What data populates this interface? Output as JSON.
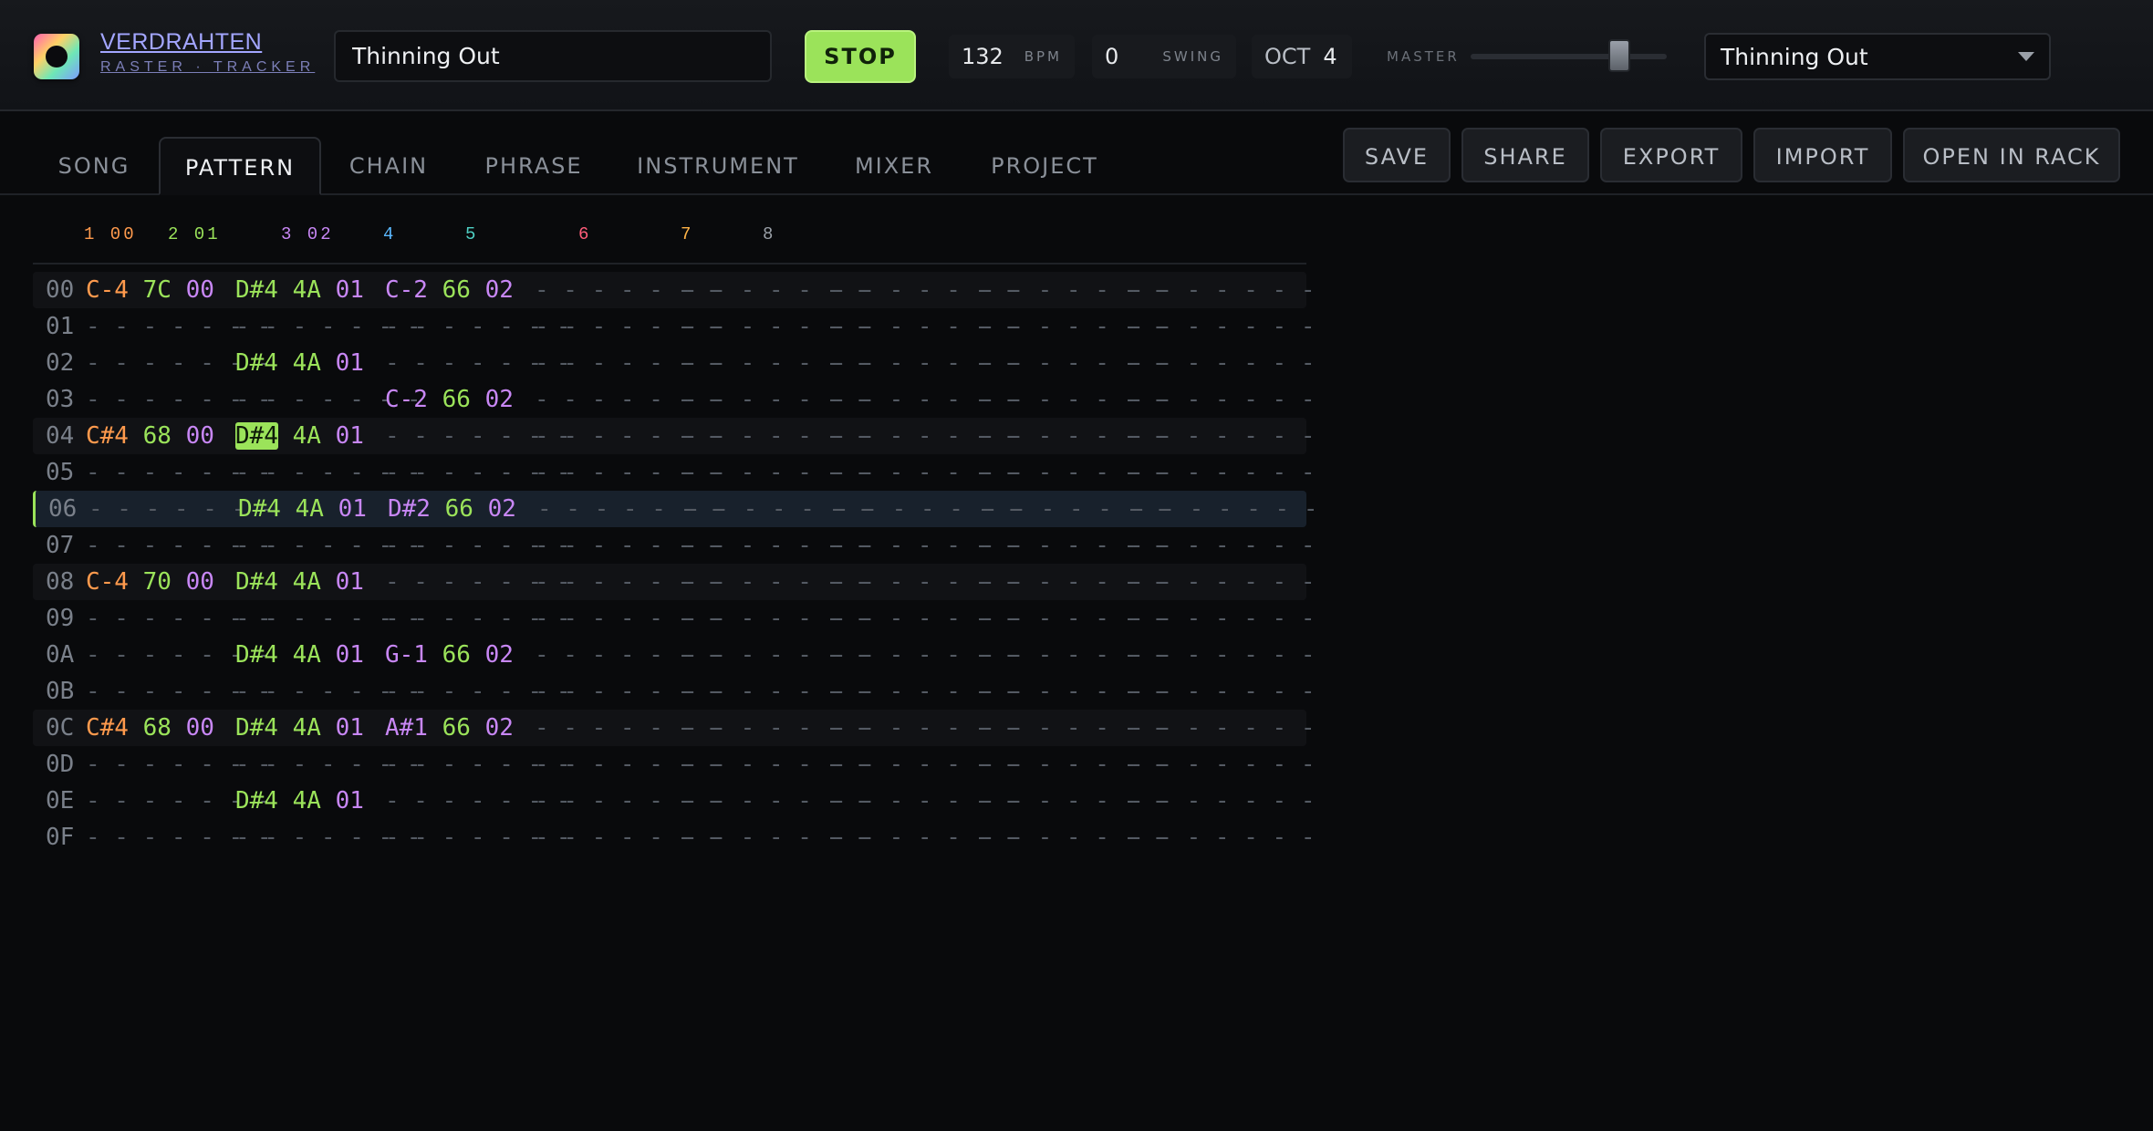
{
  "app": {
    "name": "VERDRAHTEN",
    "subtitle": "RASTER · TRACKER",
    "song_title": "Thinning Out"
  },
  "transport": {
    "stop_label": "STOP",
    "bpm_value": "132",
    "bpm_unit": "BPM",
    "swing_value": "0",
    "swing_unit": "SWING",
    "octave_label": "OCT",
    "octave_value": "4",
    "master_label": "MASTER",
    "master_level": 0.76,
    "preset_value": "Thinning Out"
  },
  "tabs": [
    {
      "label": "SONG",
      "active": false
    },
    {
      "label": "PATTERN",
      "active": true
    },
    {
      "label": "CHAIN",
      "active": false
    },
    {
      "label": "PHRASE",
      "active": false
    },
    {
      "label": "INSTRUMENT",
      "active": false
    },
    {
      "label": "MIXER",
      "active": false
    },
    {
      "label": "PROJECT",
      "active": false
    }
  ],
  "actions": [
    "SAVE",
    "SHARE",
    "EXPORT",
    "IMPORT",
    "OPEN IN RACK"
  ],
  "colors": {
    "accent": "#9be35a",
    "fx": "#c887f5",
    "empty": "#545a63"
  },
  "channels": [
    {
      "label": "1 00",
      "color": "#ff9a4d"
    },
    {
      "label": "2 01",
      "color": "#9be35a"
    },
    {
      "label": "3 02",
      "color": "#c887f5"
    },
    {
      "label": "4",
      "color": "#5bb8ff"
    },
    {
      "label": "5",
      "color": "#4fd1c5"
    },
    {
      "label": "6",
      "color": "#ff5d7a"
    },
    {
      "label": "7",
      "color": "#ffb347"
    },
    {
      "label": "8",
      "color": "#9aa0a8"
    }
  ],
  "pattern": {
    "empty_cell": "-------",
    "cursor": {
      "row": 4,
      "col": 1
    },
    "playhead_row": 6,
    "beat_rows": [
      0,
      4,
      8,
      12
    ],
    "rows": [
      {
        "num": "00",
        "cells": [
          {
            "note": "C-4",
            "ins": "7C",
            "fx": "00",
            "color": "#ff9a4d"
          },
          {
            "note": "D#4",
            "ins": "4A",
            "fx": "01",
            "color": "#9be35a"
          },
          {
            "note": "C-2",
            "ins": "66",
            "fx": "02",
            "color": "#c887f5"
          },
          null,
          null,
          null,
          null,
          null
        ]
      },
      {
        "num": "01",
        "cells": [
          null,
          null,
          null,
          null,
          null,
          null,
          null,
          null
        ]
      },
      {
        "num": "02",
        "cells": [
          null,
          {
            "note": "D#4",
            "ins": "4A",
            "fx": "01",
            "color": "#9be35a"
          },
          null,
          null,
          null,
          null,
          null,
          null
        ]
      },
      {
        "num": "03",
        "cells": [
          null,
          null,
          {
            "note": "C-2",
            "ins": "66",
            "fx": "02",
            "color": "#c887f5"
          },
          null,
          null,
          null,
          null,
          null
        ]
      },
      {
        "num": "04",
        "cells": [
          {
            "note": "C#4",
            "ins": "68",
            "fx": "00",
            "color": "#ff9a4d"
          },
          {
            "note": "D#4",
            "ins": "4A",
            "fx": "01",
            "color": "#9be35a"
          },
          null,
          null,
          null,
          null,
          null,
          null
        ]
      },
      {
        "num": "05",
        "cells": [
          null,
          null,
          null,
          null,
          null,
          null,
          null,
          null
        ]
      },
      {
        "num": "06",
        "cells": [
          null,
          {
            "note": "D#4",
            "ins": "4A",
            "fx": "01",
            "color": "#9be35a"
          },
          {
            "note": "D#2",
            "ins": "66",
            "fx": "02",
            "color": "#c887f5"
          },
          null,
          null,
          null,
          null,
          null
        ]
      },
      {
        "num": "07",
        "cells": [
          null,
          null,
          null,
          null,
          null,
          null,
          null,
          null
        ]
      },
      {
        "num": "08",
        "cells": [
          {
            "note": "C-4",
            "ins": "70",
            "fx": "00",
            "color": "#ff9a4d"
          },
          {
            "note": "D#4",
            "ins": "4A",
            "fx": "01",
            "color": "#9be35a"
          },
          null,
          null,
          null,
          null,
          null,
          null
        ]
      },
      {
        "num": "09",
        "cells": [
          null,
          null,
          null,
          null,
          null,
          null,
          null,
          null
        ]
      },
      {
        "num": "0A",
        "cells": [
          null,
          {
            "note": "D#4",
            "ins": "4A",
            "fx": "01",
            "color": "#9be35a"
          },
          {
            "note": "G-1",
            "ins": "66",
            "fx": "02",
            "color": "#c887f5"
          },
          null,
          null,
          null,
          null,
          null
        ]
      },
      {
        "num": "0B",
        "cells": [
          null,
          null,
          null,
          null,
          null,
          null,
          null,
          null
        ]
      },
      {
        "num": "0C",
        "cells": [
          {
            "note": "C#4",
            "ins": "68",
            "fx": "00",
            "color": "#ff9a4d"
          },
          {
            "note": "D#4",
            "ins": "4A",
            "fx": "01",
            "color": "#9be35a"
          },
          {
            "note": "A#1",
            "ins": "66",
            "fx": "02",
            "color": "#c887f5"
          },
          null,
          null,
          null,
          null,
          null
        ]
      },
      {
        "num": "0D",
        "cells": [
          null,
          null,
          null,
          null,
          null,
          null,
          null,
          null
        ]
      },
      {
        "num": "0E",
        "cells": [
          null,
          {
            "note": "D#4",
            "ins": "4A",
            "fx": "01",
            "color": "#9be35a"
          },
          null,
          null,
          null,
          null,
          null,
          null
        ]
      },
      {
        "num": "0F",
        "cells": [
          null,
          null,
          null,
          null,
          null,
          null,
          null,
          null
        ]
      }
    ]
  }
}
